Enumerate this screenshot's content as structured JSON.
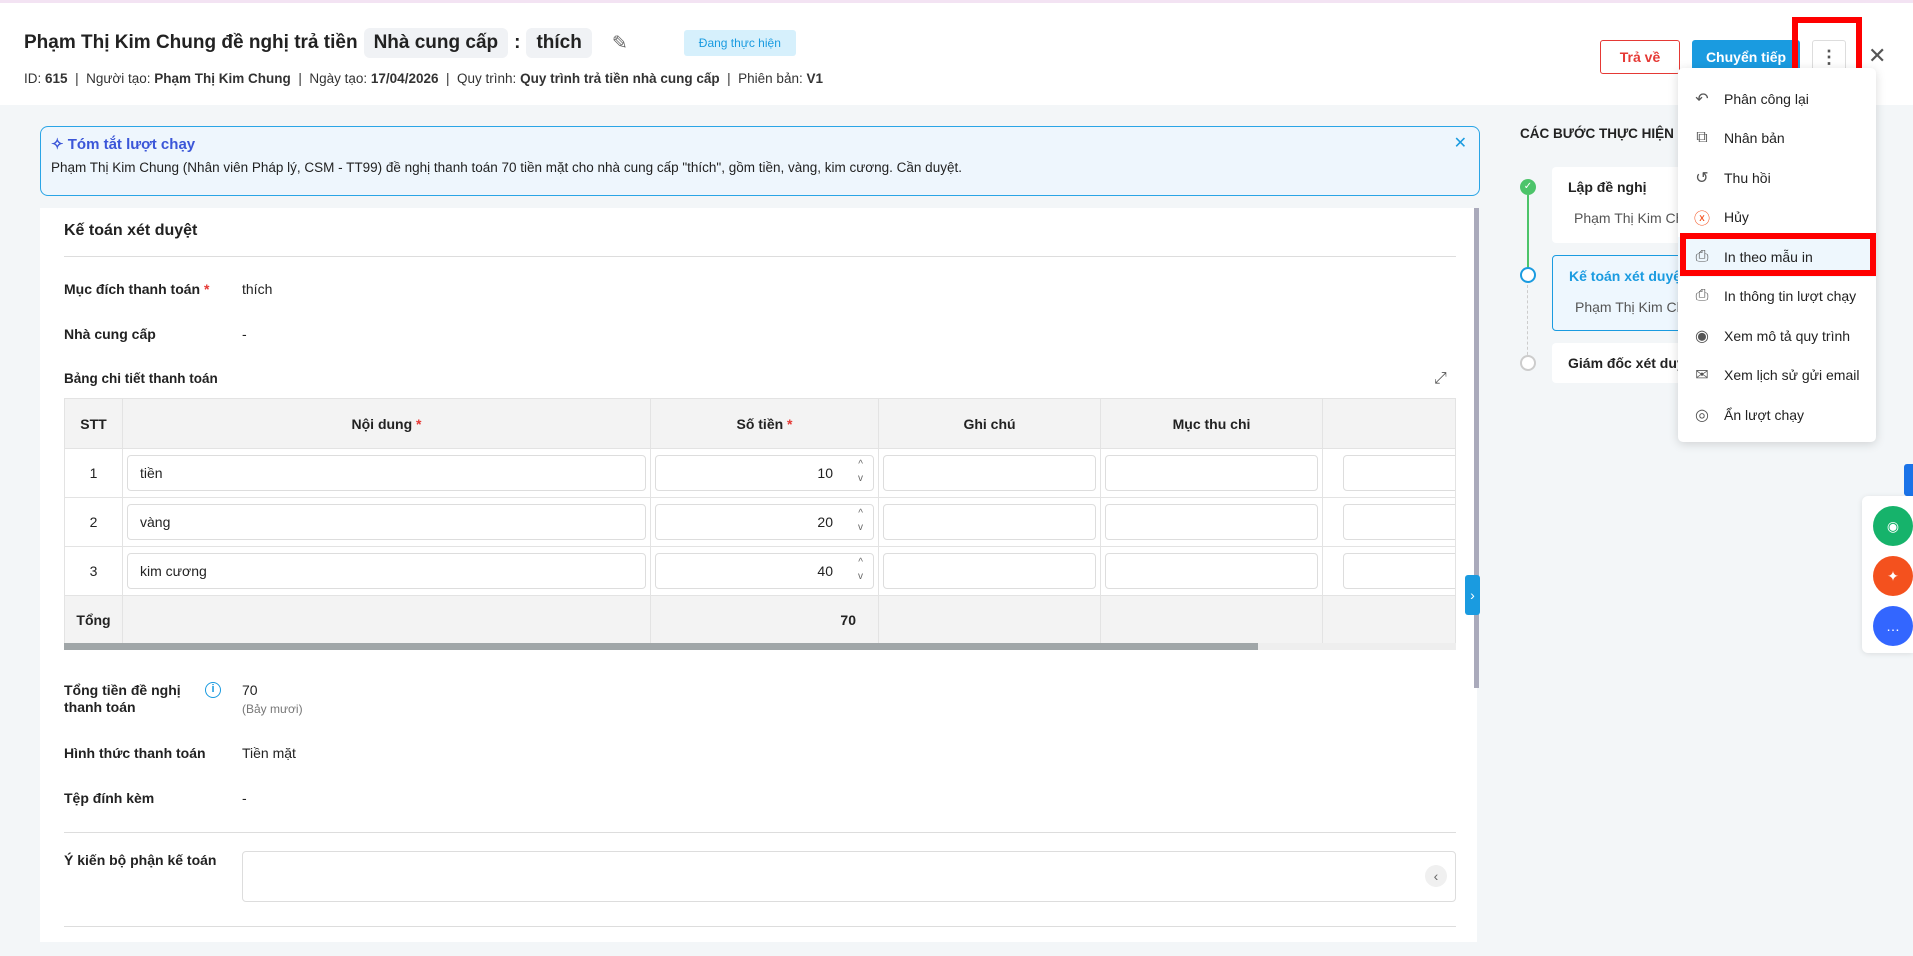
{
  "header": {
    "title_prefix": "Phạm Thị Kim Chung đề nghị trả tiền",
    "chip_field": "Nhà cung cấp",
    "colon": ":",
    "chip_value": "thích",
    "status": "Đang thực hiện",
    "meta": {
      "id_label": "ID:",
      "id": "615",
      "creator_label": "Người tạo:",
      "creator": "Phạm Thị Kim Chung",
      "date_label": "Ngày tạo:",
      "date": "17/04/2026",
      "process_label": "Quy trình:",
      "process": "Quy trình trả tiền nhà cung cấp",
      "version_label": "Phiên bản:",
      "version": "V1",
      "sep": "|"
    },
    "return_button": "Trả về",
    "forward_button": "Chuyển tiếp"
  },
  "summary": {
    "title": "Tóm tắt lượt chạy",
    "text": "Phạm Thị Kim Chung (Nhân viên Pháp lý, CSM - TT99) đề nghị thanh toán 70 tiền mặt cho nhà cung cấp \"thích\", gồm tiền, vàng, kim cương. Cần duyệt."
  },
  "form": {
    "section_title": "Kế toán xét duyệt",
    "required_mark": "*",
    "purpose_label": "Mục đích thanh toán",
    "purpose": "thích",
    "supplier_label": "Nhà cung cấp",
    "supplier": "-",
    "table_title": "Bảng chi tiết thanh toán",
    "columns": [
      "STT",
      "Nội dung",
      "Số tiền",
      "Ghi chú",
      "Mục thu chi",
      ""
    ],
    "rows": [
      {
        "stt": "1",
        "content": "tiền",
        "amount": "10"
      },
      {
        "stt": "2",
        "content": "vàng",
        "amount": "20"
      },
      {
        "stt": "3",
        "content": "kim cương",
        "amount": "40"
      }
    ],
    "total_label": "Tổng",
    "total": "70",
    "total_amount_label_1": "Tổng tiền đề nghị",
    "total_amount_label_2": "thanh toán",
    "total_amount": "70",
    "total_amount_words": "(Bảy mươi)",
    "payment_method_label": "Hình thức thanh toán",
    "payment_method": "Tiền mặt",
    "attachment_label": "Tệp đính kèm",
    "attachment": "-",
    "opinion_label": "Ý kiến bộ phận kế toán"
  },
  "steps": {
    "title": "CÁC BƯỚC THỰC HIỆN",
    "items": [
      {
        "name": "Lập đề nghị",
        "person": "Phạm Thị Kim Chung",
        "state": "done"
      },
      {
        "name": "Kế toán xét duyệt",
        "person": "Phạm Thị Kim Chung",
        "state": "current"
      },
      {
        "name": "Giám đốc xét duyệt",
        "state": "pending"
      }
    ]
  },
  "menu": {
    "items": [
      {
        "label": "Phân công lại",
        "icon": "reassign-icon"
      },
      {
        "label": "Nhân bản",
        "icon": "duplicate-icon"
      },
      {
        "label": "Thu hồi",
        "icon": "revoke-icon"
      },
      {
        "label": "Hủy",
        "icon": "cancel-icon"
      },
      {
        "label": "In theo mẫu in",
        "icon": "print-icon"
      },
      {
        "label": "In thông tin lượt chạy",
        "icon": "print-icon"
      },
      {
        "label": "Xem mô tả quy trình",
        "icon": "eye-icon"
      },
      {
        "label": "Xem lịch sử gửi email",
        "icon": "mail-icon"
      },
      {
        "label": "Ẩn lượt chạy",
        "icon": "hide-icon"
      }
    ]
  },
  "colors": {
    "primary": "#1a9be0",
    "danger": "#e53935",
    "highlight": "#ff0000"
  }
}
